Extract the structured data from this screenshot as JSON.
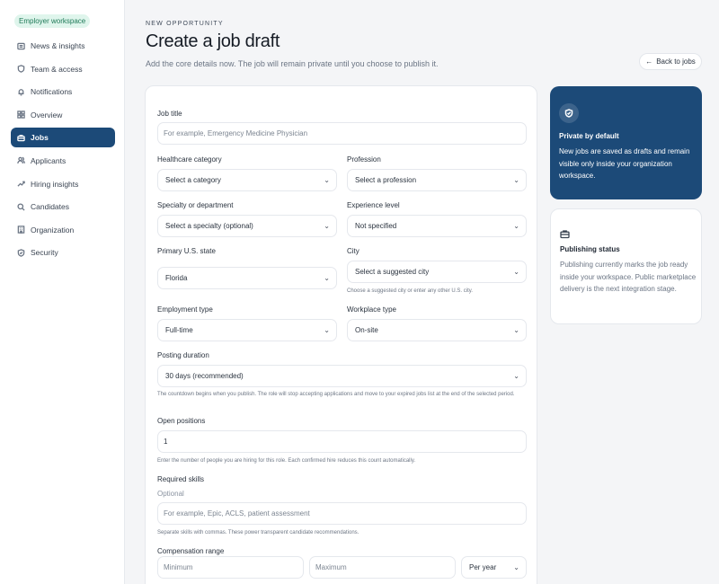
{
  "sidebar": {
    "badge": "Employer workspace",
    "items": [
      {
        "label": "News & insights",
        "icon": "newspaper-icon"
      },
      {
        "label": "Team & access",
        "icon": "shield-icon"
      },
      {
        "label": "Notifications",
        "icon": "bell-icon"
      },
      {
        "label": "Overview",
        "icon": "grid-icon"
      },
      {
        "label": "Jobs",
        "icon": "briefcase-icon",
        "active": true
      },
      {
        "label": "Applicants",
        "icon": "users-icon"
      },
      {
        "label": "Hiring insights",
        "icon": "trend-icon"
      },
      {
        "label": "Candidates",
        "icon": "search-icon"
      },
      {
        "label": "Organization",
        "icon": "building-icon"
      },
      {
        "label": "Security",
        "icon": "shield-check-icon"
      }
    ]
  },
  "header": {
    "eyebrow": "NEW OPPORTUNITY",
    "title": "Create a job draft",
    "subtitle": "Add the core details now. The job will remain private until you choose to publish it.",
    "back_label": "Back to jobs"
  },
  "form": {
    "job_title": {
      "label": "Job title",
      "placeholder": "For example, Emergency Medicine Physician"
    },
    "category": {
      "label": "Healthcare category",
      "value": "Select a category"
    },
    "profession": {
      "label": "Profession",
      "value": "Select a profession"
    },
    "specialty": {
      "label": "Specialty or department",
      "value": "Select a specialty (optional)"
    },
    "experience": {
      "label": "Experience level",
      "value": "Not specified"
    },
    "state": {
      "label": "Primary U.S. state",
      "value": "Florida"
    },
    "city": {
      "label": "City",
      "value": "Select a suggested city",
      "help": "Choose a suggested city or enter any other U.S. city."
    },
    "employment": {
      "label": "Employment type",
      "value": "Full-time"
    },
    "workplace": {
      "label": "Workplace type",
      "value": "On-site"
    },
    "duration": {
      "label": "Posting duration",
      "value": "30 days (recommended)",
      "help": "The countdown begins when you publish. The role will stop accepting applications and move to your expired jobs list at the end of the selected period."
    },
    "positions": {
      "label": "Open positions",
      "value": "1",
      "help": "Enter the number of people you are hiring for this role. Each confirmed hire reduces this count automatically."
    },
    "skills": {
      "label": "Required skills",
      "optional": "Optional",
      "placeholder": "For example, Epic, ACLS, patient assessment",
      "help": "Separate skills with commas. These power transparent candidate recommendations."
    },
    "compensation": {
      "label": "Compensation range",
      "min_placeholder": "Minimum",
      "max_placeholder": "Maximum",
      "period": "Per year"
    }
  },
  "private_card": {
    "title": "Private by default",
    "body": "New jobs are saved as drafts and remain visible only inside your organization workspace."
  },
  "status_card": {
    "title": "Publishing status",
    "body": "Publishing currently marks the job ready inside your workspace. Public marketplace delivery is the next integration stage."
  },
  "colors": {
    "accent": "#1c4a78",
    "badge_bg": "#dff5ec",
    "badge_text": "#1f7a58"
  }
}
